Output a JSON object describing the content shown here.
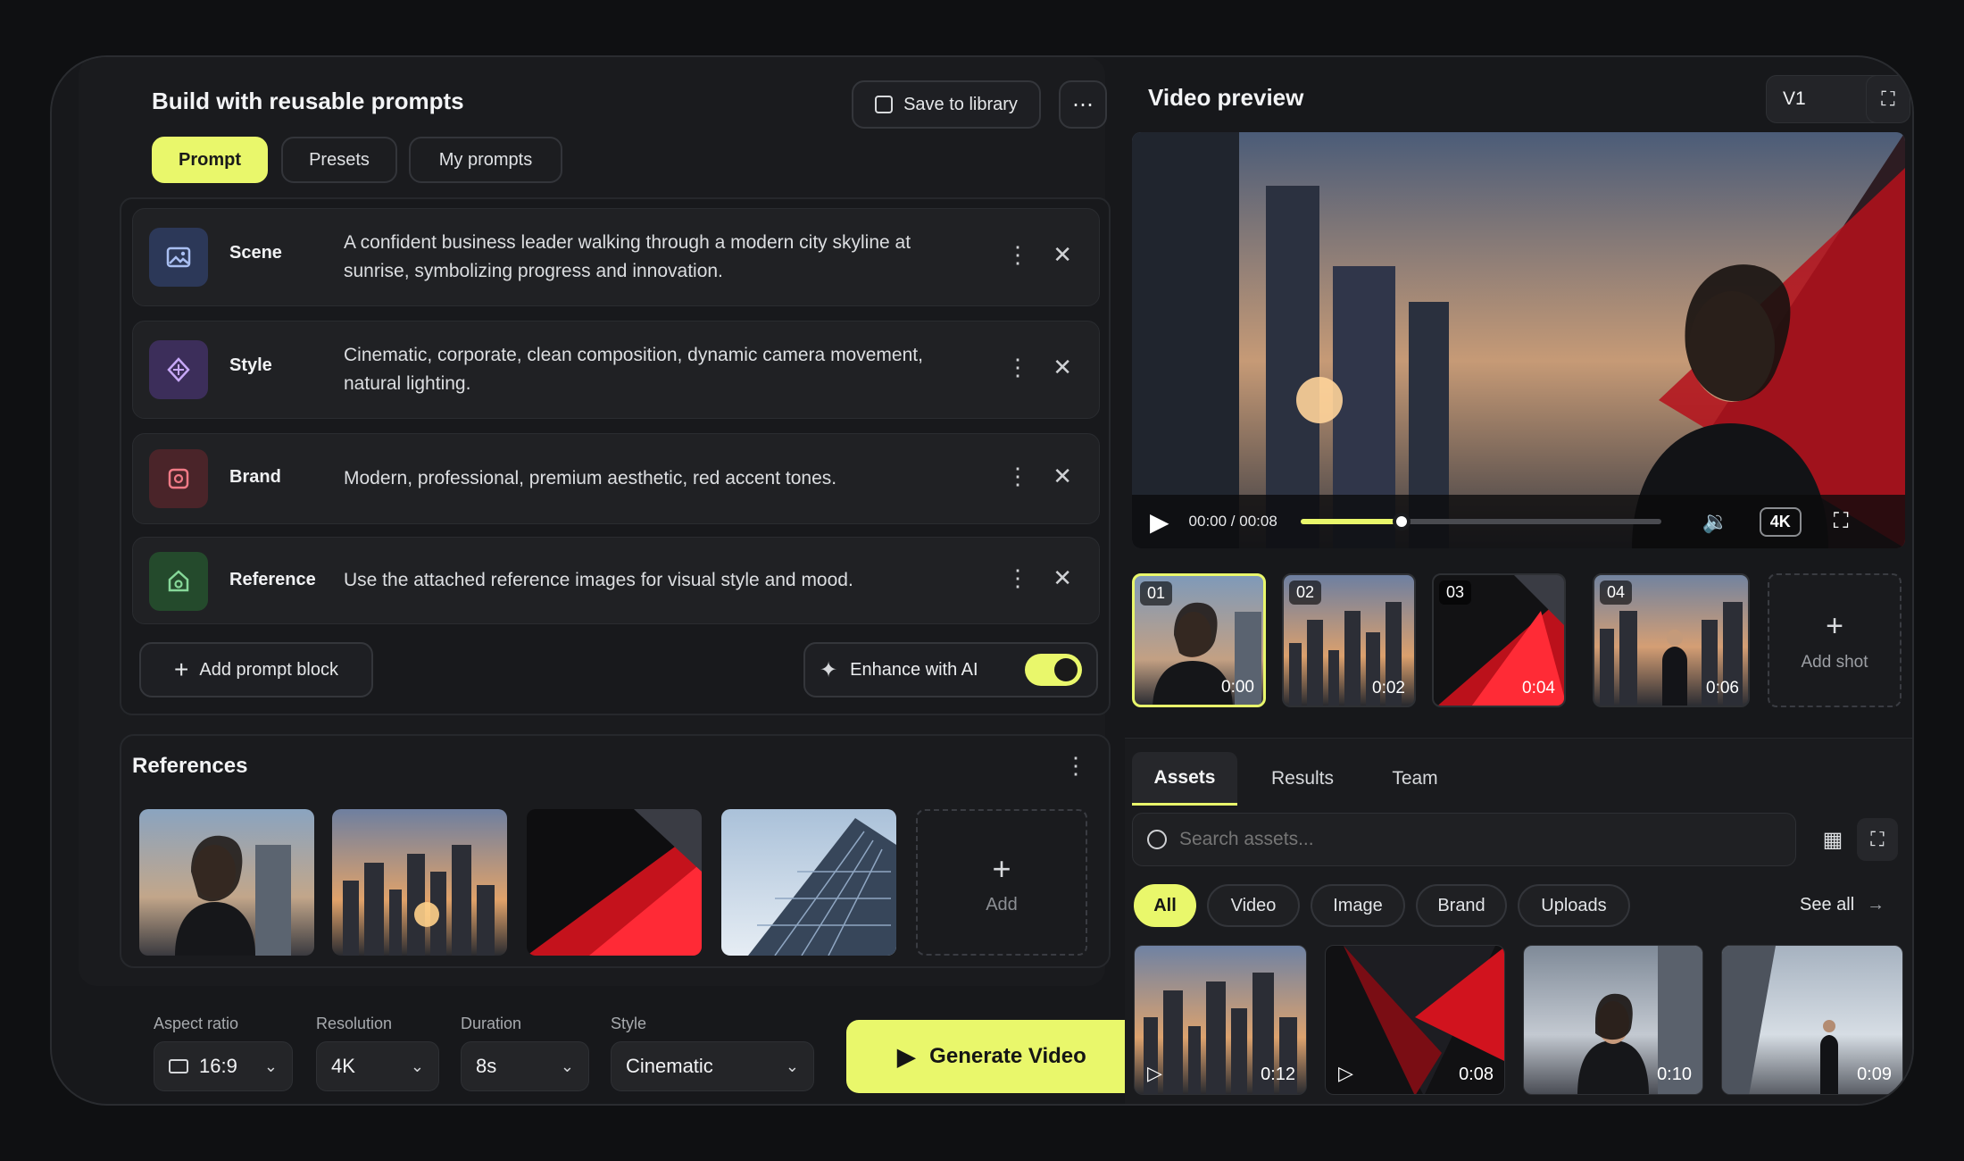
{
  "left": {
    "title": "Build with reusable prompts",
    "save_label": "Save to library",
    "more_label": "⋯",
    "tabs": [
      "Prompt",
      "Presets",
      "My prompts"
    ],
    "blocks": [
      {
        "name": "Scene",
        "text": "A confident business leader walking through a modern city skyline at sunrise, symbolizing progress and innovation.",
        "icon": "image-icon",
        "color": "#5d7bc4"
      },
      {
        "name": "Style",
        "text": "Cinematic, corporate, clean composition, dynamic camera movement, natural lighting.",
        "icon": "style-icon",
        "color": "#9b6ee0"
      },
      {
        "name": "Brand",
        "text": "Modern, professional, premium aesthetic, red accent tones.",
        "icon": "brand-icon",
        "color": "#e0525e"
      },
      {
        "name": "Reference",
        "text": "Use the attached reference images for visual style and mood.",
        "icon": "reference-icon",
        "color": "#55b067"
      }
    ],
    "add_block_label": "Add prompt block",
    "enhance_label": "Enhance with AI",
    "enhance_on": true,
    "references_title": "References",
    "add_ref_label": "Add",
    "settings": {
      "aspect_label": "Aspect ratio",
      "aspect_value": "16:9",
      "resolution_label": "Resolution",
      "resolution_value": "4K",
      "duration_label": "Duration",
      "duration_value": "8s",
      "style_label": "Style",
      "style_value": "Cinematic"
    },
    "generate_label": "Generate Video"
  },
  "right": {
    "title": "Video preview",
    "version": "V1",
    "time": "00:00 / 00:08",
    "progress": 0.28,
    "quality": "4K",
    "shots": [
      {
        "n": "01",
        "t": "0:00"
      },
      {
        "n": "02",
        "t": "0:02"
      },
      {
        "n": "03",
        "t": "0:04"
      },
      {
        "n": "04",
        "t": "0:06"
      }
    ],
    "add_shot_label": "Add shot",
    "tabs": [
      "Assets",
      "Results",
      "Team"
    ],
    "search_placeholder": "Search assets...",
    "chips": [
      "All",
      "Video",
      "Image",
      "Brand",
      "Uploads"
    ],
    "see_all": "See all",
    "assets": [
      {
        "t": "0:12"
      },
      {
        "t": "0:08"
      },
      {
        "t": "0:10"
      },
      {
        "t": "0:09"
      }
    ],
    "accent": "#e9f76b"
  }
}
